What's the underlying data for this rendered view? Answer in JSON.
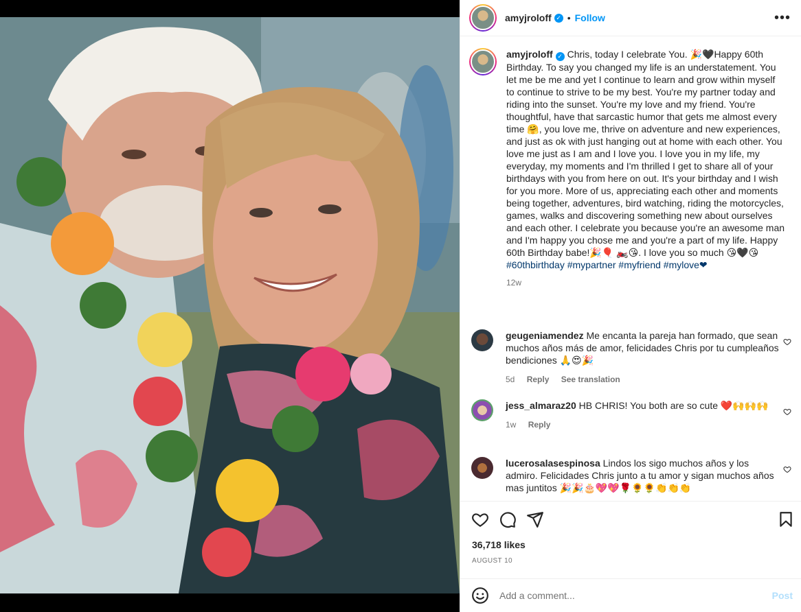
{
  "post": {
    "username": "amyjroloff",
    "verified_icon": "verified-badge-icon",
    "dot": "•",
    "follow_label": "Follow",
    "more_icon": "more-horizontal-icon",
    "photo_description_icon": "post-photo"
  },
  "caption": {
    "username": "amyjroloff",
    "text": " Chris, today I celebrate You. 🎉🖤Happy 60th Birthday. To say you changed my life is an understatement. You let me be me and yet I continue to learn and grow within myself to continue to strive to be my best. You're my partner today and riding into the sunset. You're my love and my friend. You're thoughtful, have that sarcastic humor that gets me almost every time 🤗, you love me, thrive on adventure and new experiences, and just as ok with just hanging out at home with each other. You love me just as I am and I love you. I love you in my life, my everyday, my moments and I'm thrilled I get to share all of your birthdays with you from here on out. It's your birthday and I wish for you more. More of us, appreciating each other and moments being together, adventures, bird watching, riding the motorcycles, games, walks and discovering something new about ourselves and each other. I celebrate you because you're an awesome man and I'm happy you chose me and you're a part of my life. Happy 60th Birthday babe!🎉🎈 🏍️😘. I love you so much 😘🖤😘",
    "hashtags": "#60thbirthday #mypartner #myfriend #mylove❤",
    "age": "12w"
  },
  "comments": [
    {
      "username": "geugeniamendez",
      "text": " Me encanta la pareja han formado, que sean muchos años más de amor, felicidades Chris por tu cumpleaños bendiciones 🙏😍🎉",
      "age": "5d",
      "reply": "Reply",
      "translate": "See translation"
    },
    {
      "username": "jess_almaraz20",
      "text": " HB CHRIS! You both are so cute ❤️🙌🙌🙌",
      "age": "1w",
      "reply": "Reply"
    },
    {
      "username": "lucerosalasespinosa",
      "text": " Lindos los sigo muchos años y los admiro. Felicidades Chris junto a tu amor y sigan muchos años mas juntitos 🎉🎉🎂💖💖🌹🌻🌻👏👏👏",
      "age": "",
      "reply": ""
    }
  ],
  "stats": {
    "likes": "36,718 likes",
    "date": "AUGUST 10"
  },
  "composer": {
    "placeholder": "Add a comment...",
    "post_label": "Post"
  },
  "colors": {
    "link_blue": "#0095f6",
    "hashtag": "#00376b",
    "post_disabled": "#b2dffc"
  }
}
